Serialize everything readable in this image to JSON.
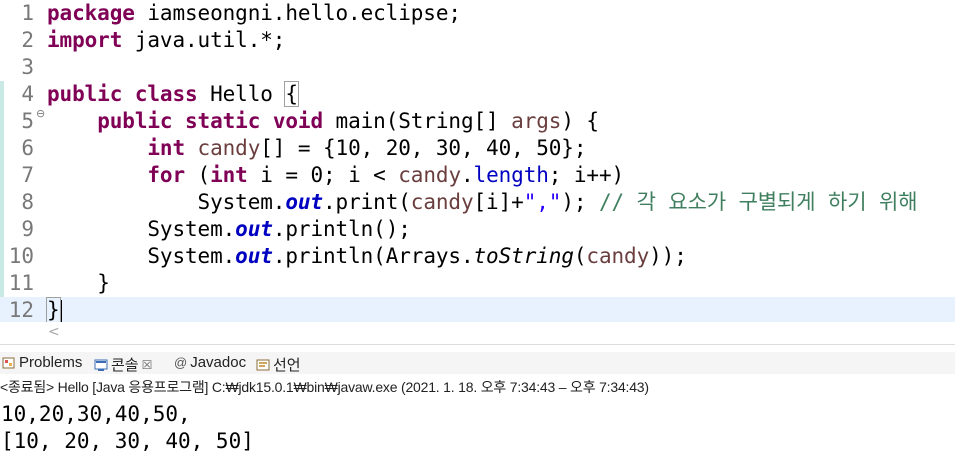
{
  "editor": {
    "line_numbers": [
      "1",
      "2",
      "3",
      "4",
      "5",
      "6",
      "7",
      "8",
      "9",
      "10",
      "11",
      "12"
    ],
    "l1": {
      "kw": "package",
      "rest": " iamseongni.hello.eclipse;"
    },
    "l2": {
      "kw": "import",
      "rest": " java.util.*;"
    },
    "l4": {
      "kw1": "public",
      "kw2": "class",
      "name": " Hello ",
      "brace": "{"
    },
    "l5": {
      "indent": "    ",
      "kw1": "public",
      "kw2": "static",
      "kw3": "void",
      "sig": " main(String[] ",
      "param": "args",
      "end": ") {"
    },
    "l6": {
      "indent": "        ",
      "kw": "int",
      "var": "candy",
      "rest": "[] = {10, 20, 30, 40, 50};"
    },
    "l7": {
      "indent": "        ",
      "kw1": "for",
      "p1": " (",
      "kw2": "int",
      "p2": " i = 0; i < ",
      "var": "candy",
      "dot": ".",
      "fld": "length",
      "p3": "; i++)"
    },
    "l8": {
      "indent": "            ",
      "sys": "System.",
      "sfld": "out",
      "call": ".print(",
      "var": "candy",
      "idx": "[i]+",
      "str": "\",\"",
      "close": "); ",
      "cmt": "// 각 요소가 구별되게 하기 위해"
    },
    "l9": {
      "indent": "        ",
      "sys": "System.",
      "sfld": "out",
      "call": ".println();"
    },
    "l10": {
      "indent": "        ",
      "sys": "System.",
      "sfld": "out",
      "call": ".println(Arrays.",
      "smeth": "toString",
      "p": "(",
      "var": "candy",
      "end": "));"
    },
    "l11": {
      "indent": "    ",
      "brace": "}"
    },
    "l12": {
      "brace": "}"
    },
    "fold_marker": "⊖",
    "scroll_left": "<"
  },
  "console_tabs": [
    {
      "label": "Problems",
      "icon": "problems-icon"
    },
    {
      "label": "콘솔",
      "icon": "console-icon",
      "close": "☒"
    },
    {
      "label": "Javadoc",
      "icon": "javadoc-icon"
    },
    {
      "label": "선언",
      "icon": "declaration-icon"
    }
  ],
  "status": "<종료됨> Hello [Java 응용프로그램] C:₩jdk15.0.1₩bin₩javaw.exe (2021. 1. 18. 오후 7:34:43 – 오후 7:34:43)",
  "console_output": [
    "10,20,30,40,50,",
    "[10, 20, 30, 40, 50]"
  ]
}
